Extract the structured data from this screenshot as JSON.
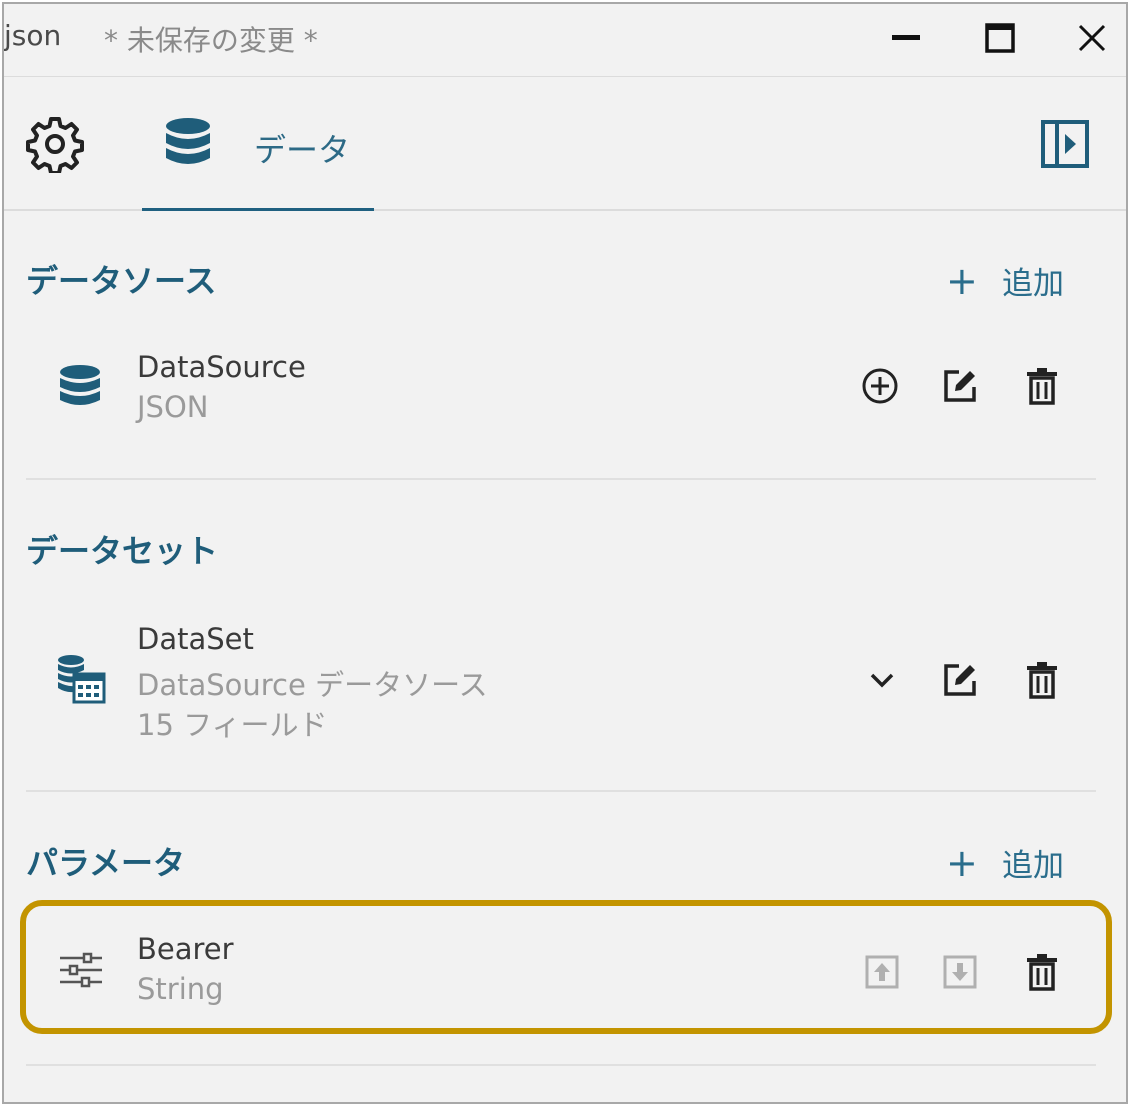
{
  "window": {
    "title": "json",
    "unsaved": "* 未保存の変更 *"
  },
  "tabs": {
    "settings_icon": "gear-icon",
    "data_tab_label": "データ",
    "panel_icon": "sidebar-toggle-icon"
  },
  "datasources": {
    "title": "データソース",
    "add_label": "追加",
    "items": [
      {
        "name": "DataSource",
        "type": "JSON"
      }
    ]
  },
  "datasets": {
    "title": "データセット",
    "items": [
      {
        "name": "DataSet",
        "source": "DataSource データソース",
        "fields": "15 フィールド"
      }
    ]
  },
  "parameters": {
    "title": "パラメータ",
    "add_label": "追加",
    "items": [
      {
        "name": "Bearer",
        "type": "String"
      }
    ]
  },
  "colors": {
    "accent": "#1f5d7a",
    "highlight": "#c39400"
  }
}
